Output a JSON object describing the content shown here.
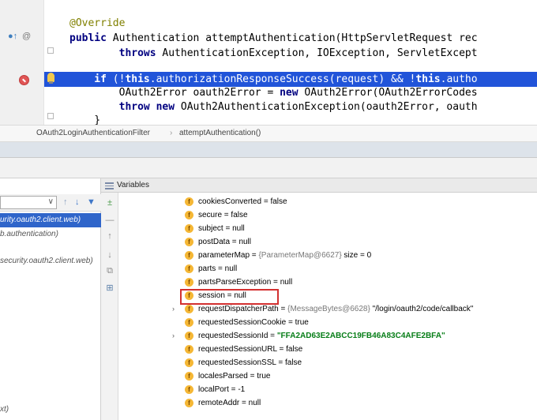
{
  "editor": {
    "lines": [
      {
        "id": "override",
        "parts": [
          {
            "t": "@Override",
            "c": "ann"
          }
        ]
      },
      {
        "id": "sig",
        "parts": [
          {
            "t": "public",
            "c": "kw"
          },
          {
            "t": " Authentication attemptAuthentication(HttpServletRequest rec",
            "c": ""
          }
        ]
      },
      {
        "id": "throws",
        "parts": [
          {
            "t": "        throws",
            "c": "kw"
          },
          {
            "t": " AuthenticationException, IOException, ServletExcept",
            "c": ""
          }
        ]
      },
      {
        "id": "blank",
        "parts": [
          {
            "t": "",
            "c": ""
          }
        ]
      },
      {
        "id": "if",
        "parts": [
          {
            "t": "    if",
            "c": "kw"
          },
          {
            "t": " (!",
            "c": ""
          },
          {
            "t": "this",
            "c": "kw"
          },
          {
            "t": ".authorizationResponseSuccess(request) && !",
            "c": ""
          },
          {
            "t": "this",
            "c": "kw"
          },
          {
            "t": ".autho",
            "c": ""
          }
        ]
      },
      {
        "id": "err",
        "parts": [
          {
            "t": "        OAuth2Error oauth2Error = ",
            "c": ""
          },
          {
            "t": "new",
            "c": "kw"
          },
          {
            "t": " OAuth2Error(OAuth2ErrorCodes",
            "c": ""
          }
        ]
      },
      {
        "id": "thrownew",
        "parts": [
          {
            "t": "        throw",
            "c": "kw"
          },
          {
            "t": " ",
            "c": ""
          },
          {
            "t": "new",
            "c": "kw"
          },
          {
            "t": " OAuth2AuthenticationException(oauth2Error, oauth",
            "c": ""
          }
        ]
      },
      {
        "id": "brace",
        "parts": [
          {
            "t": "    }",
            "c": ""
          }
        ]
      }
    ]
  },
  "breadcrumb": {
    "class_name": "OAuth2LoginAuthenticationFilter",
    "separator": "›",
    "method": "attemptAuthentication()"
  },
  "frames": {
    "rows": [
      {
        "text": "urity.oauth2.client.web)",
        "selected": true
      },
      {
        "text": "b.authentication)",
        "selected": false
      },
      {
        "text": "",
        "selected": false
      },
      {
        "text": "security.oauth2.client.web)",
        "selected": false
      },
      {
        "text": "xt)",
        "selected": false
      }
    ]
  },
  "variables": {
    "title": "Variables",
    "rows": [
      {
        "name": "cookiesConverted",
        "eq": " = ",
        "value": "false",
        "expandable": false
      },
      {
        "name": "secure",
        "eq": " = ",
        "value": "false",
        "expandable": false
      },
      {
        "name": "subject",
        "eq": " = ",
        "value": "null",
        "expandable": false
      },
      {
        "name": "postData",
        "eq": " = ",
        "value": "null",
        "expandable": false
      },
      {
        "name": "parameterMap",
        "eq": " = ",
        "ref": "{ParameterMap@6627}",
        "value": "  size = 0",
        "expandable": false
      },
      {
        "name": "parts",
        "eq": " = ",
        "value": "null",
        "expandable": false
      },
      {
        "name": "partsParseException",
        "eq": " = ",
        "value": "null",
        "expandable": false
      },
      {
        "name": "session",
        "eq": " = ",
        "value": "null",
        "expandable": false
      },
      {
        "name": "requestDispatcherPath",
        "eq": " = ",
        "ref": "{MessageBytes@6628}",
        "value": " \"/login/oauth2/code/callback\"",
        "expandable": true
      },
      {
        "name": "requestedSessionCookie",
        "eq": " = ",
        "value": "true",
        "expandable": false
      },
      {
        "name": "requestedSessionId",
        "eq": " = ",
        "str": "\"FFA2AD63E2ABCC19FB46A83C4AFE2BFA\"",
        "expandable": true
      },
      {
        "name": "requestedSessionURL",
        "eq": " = ",
        "value": "false",
        "expandable": false
      },
      {
        "name": "requestedSessionSSL",
        "eq": " = ",
        "value": "false",
        "expandable": false
      },
      {
        "name": "localesParsed",
        "eq": " = ",
        "value": "true",
        "expandable": false
      },
      {
        "name": "localPort",
        "eq": " = ",
        "value": "-1",
        "expandable": false
      },
      {
        "name": "remoteAddr",
        "eq": " = ",
        "value": "null",
        "expandable": false
      }
    ]
  },
  "colors": {
    "current_line": "#2154d9",
    "keyword": "#000080",
    "annotation": "#808000",
    "field_icon": "#f5b735",
    "highlight_box": "#d33030",
    "string_value": "#067d17"
  },
  "icons": {
    "gutter_override": "override-icon",
    "breakpoint": "breakpoint-icon",
    "intention": "lightbulb-icon",
    "field": "field-icon"
  }
}
